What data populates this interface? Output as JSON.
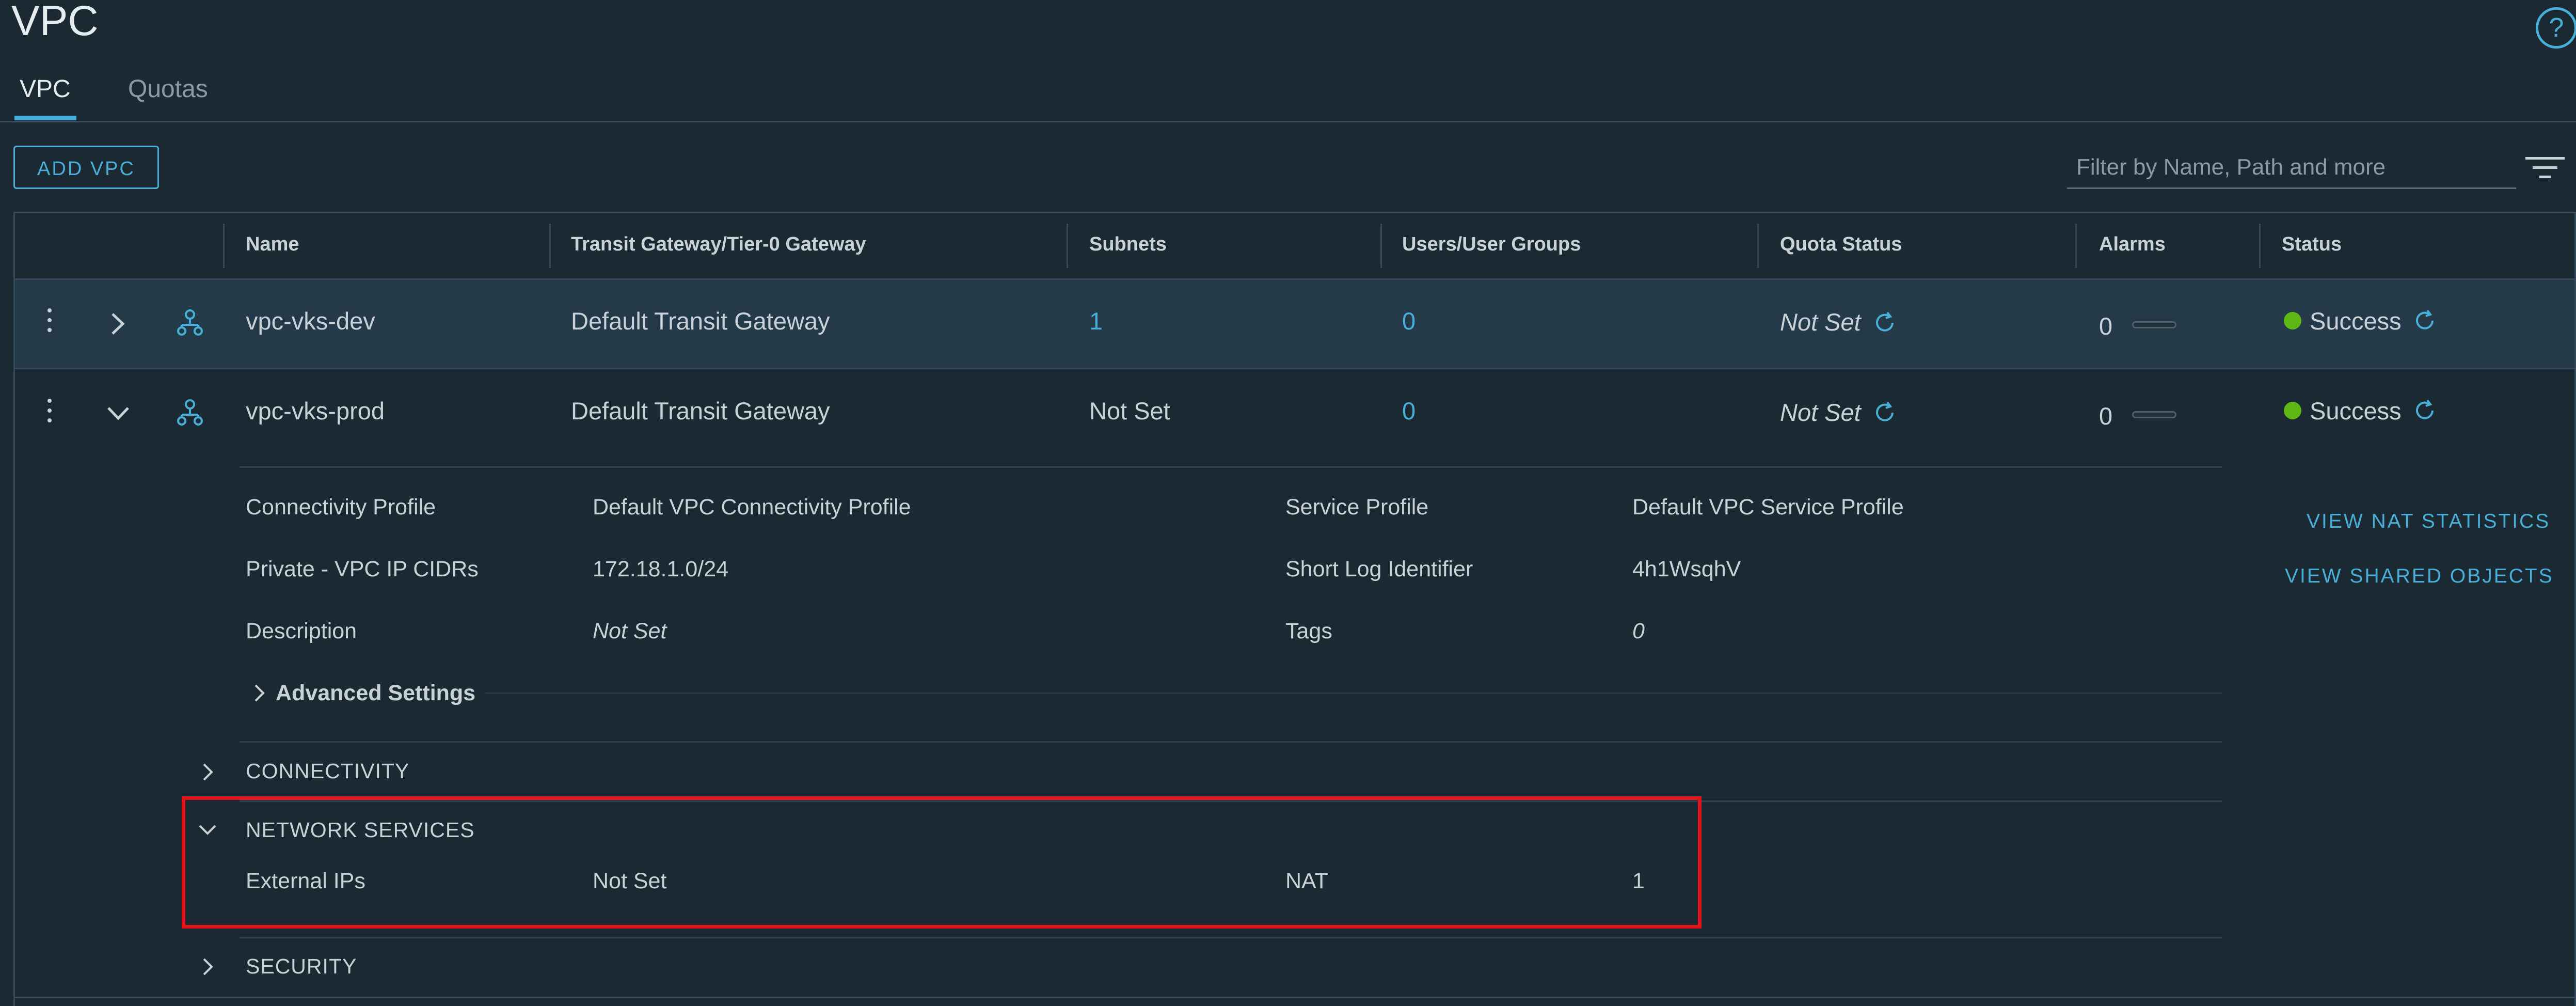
{
  "page": {
    "title": "VPC"
  },
  "tabs": [
    {
      "label": "VPC"
    },
    {
      "label": "Quotas"
    }
  ],
  "toolbar": {
    "add_label": "ADD VPC",
    "filter_placeholder": "Filter by Name, Path and more"
  },
  "table": {
    "columns": [
      "Name",
      "Transit Gateway/Tier-0 Gateway",
      "Subnets",
      "Users/User Groups",
      "Quota Status",
      "Alarms",
      "Status"
    ],
    "rows": [
      {
        "name": "vpc-vks-dev",
        "gateway": "Default Transit Gateway",
        "subnets": "1",
        "users": "0",
        "quota": "Not Set",
        "alarms": "0",
        "status": "Success"
      },
      {
        "name": "vpc-vks-prod",
        "gateway": "Default Transit Gateway",
        "subnets": "Not Set",
        "users": "0",
        "quota": "Not Set",
        "alarms": "0",
        "status": "Success"
      }
    ]
  },
  "details": {
    "connectivity_profile_label": "Connectivity Profile",
    "connectivity_profile_value": "Default VPC Connectivity Profile",
    "service_profile_label": "Service Profile",
    "service_profile_value": "Default VPC Service Profile",
    "cidrs_label": "Private - VPC IP CIDRs",
    "cidrs_value": "172.18.1.0/24",
    "short_log_label": "Short Log Identifier",
    "short_log_value": "4h1WsqhV",
    "description_label": "Description",
    "description_value": "Not Set",
    "tags_label": "Tags",
    "tags_value": "0",
    "advanced_label": "Advanced Settings",
    "view_nat_label": "VIEW NAT STATISTICS",
    "view_shared_label": "VIEW SHARED OBJECTS"
  },
  "sections": {
    "connectivity": "CONNECTIVITY",
    "network_services": "NETWORK SERVICES",
    "external_ips_label": "External IPs",
    "external_ips_value": "Not Set",
    "nat_label": "NAT",
    "nat_value": "1",
    "security": "SECURITY"
  },
  "colors": {
    "accent": "#49afd9",
    "success": "#5eb715",
    "highlight": "#e0141a",
    "background": "#1b2a32"
  },
  "icons": [
    "help-icon",
    "filter-icon",
    "kebab-icon",
    "chevron-right-icon",
    "chevron-down-icon",
    "vpc-icon",
    "refresh-icon"
  ]
}
